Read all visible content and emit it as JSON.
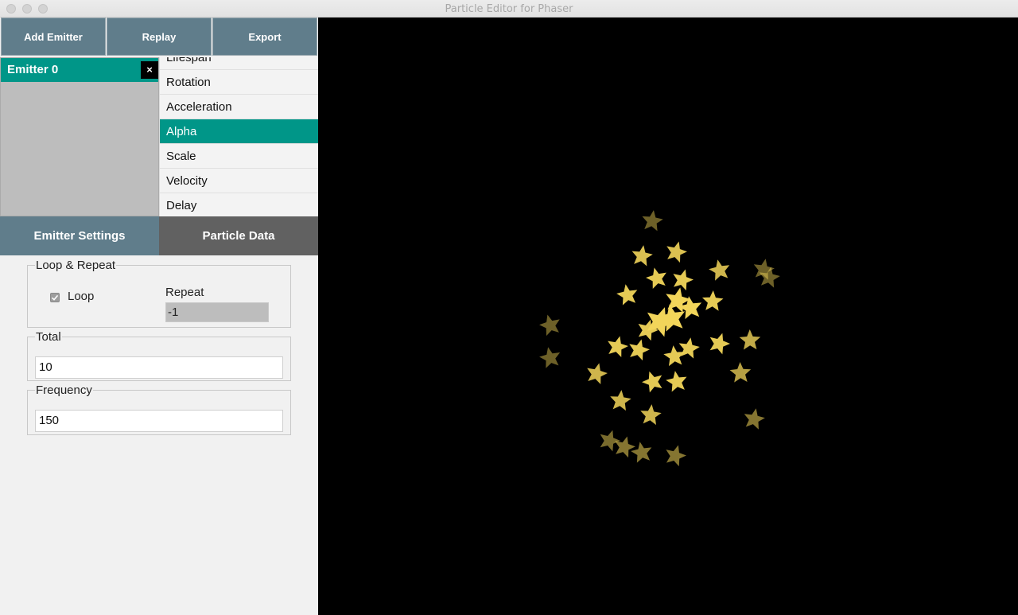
{
  "window": {
    "title": "Particle Editor for Phaser"
  },
  "toolbar": {
    "add_emitter": "Add Emitter",
    "replay": "Replay",
    "export": "Export"
  },
  "emitters": [
    {
      "name": "Emitter 0",
      "close": "×"
    }
  ],
  "properties": [
    "Lifespan",
    "Rotation",
    "Acceleration",
    "Alpha",
    "Scale",
    "Velocity",
    "Delay"
  ],
  "active_property": "Alpha",
  "tabs": {
    "emitter_settings": "Emitter Settings",
    "particle_data": "Particle Data"
  },
  "settings": {
    "loop_repeat": {
      "legend": "Loop & Repeat",
      "loop_label": "Loop",
      "loop_checked": true,
      "repeat_label": "Repeat",
      "repeat_value": "-1"
    },
    "total": {
      "legend": "Total",
      "value": "10"
    },
    "frequency": {
      "legend": "Frequency",
      "value": "150"
    }
  },
  "colors": {
    "accent": "#009688",
    "toolbar": "#607d8b",
    "tab_inactive": "#607d8b",
    "tab_active": "#616161",
    "canvas_bg": "#000000",
    "particle": "#f2d55a"
  },
  "particle_sprite": "star-icon"
}
